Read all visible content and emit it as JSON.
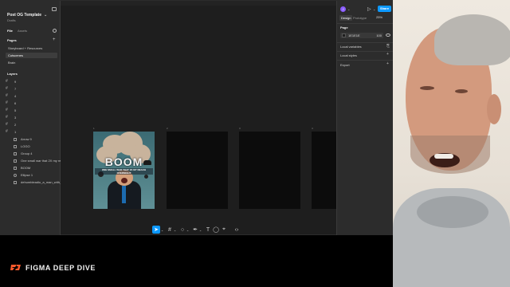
{
  "file": {
    "name": "Post OG Template",
    "subtitle": "Drafts"
  },
  "left_tabs": {
    "file": "File",
    "assets": "Assets"
  },
  "pages": {
    "title": "Pages",
    "items": [
      "Storyboard + Resources",
      "Cutscenes",
      "Brain"
    ]
  },
  "layers": {
    "title": "Layers",
    "frames": [
      "9",
      "7",
      "4",
      "6",
      "5",
      "3",
      "2",
      "1"
    ],
    "children": [
      "Arrow 9",
      "LOGO",
      "Group 4",
      "One small war that 2X my reach w",
      "BOOM",
      "Ellipse 1",
      "dehumbleadio_a_man_with_a_pla"
    ]
  },
  "canvas": {
    "frame_labels": [
      "1",
      "2",
      "3",
      "4"
    ],
    "poster": {
      "title": "BOOM",
      "subtitle": "ONE SMALL WAR THAT 2X MY REACH OVERNIGHT"
    }
  },
  "toolbar": {
    "tools": [
      "move-tool",
      "frame-tool",
      "shape-tool",
      "pen-tool",
      "text-tool",
      "comment-tool",
      "actions-tool",
      "dev-mode-tool"
    ],
    "help": "?"
  },
  "right_panel": {
    "avatar_initial": "J",
    "share": "Share",
    "tabs": [
      "Design",
      "Prototype"
    ],
    "zoom": "25%",
    "page_section": "Page",
    "bg_hex": "1E1E1E",
    "bg_opacity": "100",
    "local_variables": "Local variables",
    "local_styles": "Local styles",
    "export": "Export"
  },
  "brand": {
    "text": "FIGMA DEEP DIVE",
    "accent": "#ff5a2c"
  }
}
